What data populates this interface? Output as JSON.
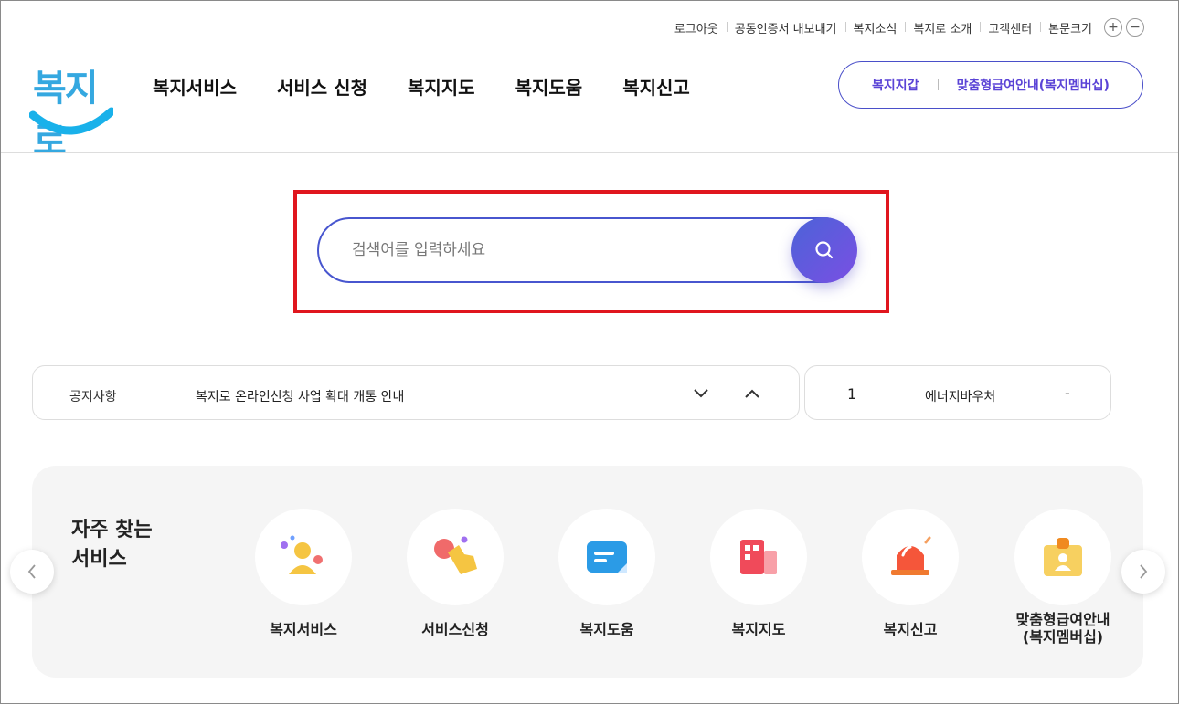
{
  "utility": {
    "items": [
      "로그아웃",
      "공동인증서 내보내기",
      "복지소식",
      "복지로 소개",
      "고객센터",
      "본문크기"
    ],
    "zoom_in": "+",
    "zoom_out": "−"
  },
  "logo": {
    "text": "복지로"
  },
  "gnb": {
    "items": [
      "복지서비스",
      "서비스 신청",
      "복지지도",
      "복지도움",
      "복지신고"
    ]
  },
  "pill": {
    "left": "복지지갑",
    "right": "맞춤형급여안내(복지멤버십)"
  },
  "search": {
    "placeholder": "검색어를 입력하세요"
  },
  "notice": {
    "label": "공지사항",
    "text": "복지로 온라인신청 사업 확대 개통 안내"
  },
  "rank": {
    "number": "1",
    "name": "에너지바우처",
    "change": "-"
  },
  "frequent": {
    "title": "자주 찾는\n서비스",
    "items": [
      {
        "label": "복지서비스",
        "icon": "person-icon"
      },
      {
        "label": "서비스신청",
        "icon": "hand-tap-icon"
      },
      {
        "label": "복지도움",
        "icon": "document-icon"
      },
      {
        "label": "복지지도",
        "icon": "building-icon"
      },
      {
        "label": "복지신고",
        "icon": "siren-icon"
      },
      {
        "label": "맞춤형급여안내\n(복지멤버십)",
        "icon": "id-card-icon"
      }
    ]
  },
  "colors": {
    "accent": "#4856cf",
    "highlight": "#e0161e",
    "logo": "#35a8e0"
  }
}
